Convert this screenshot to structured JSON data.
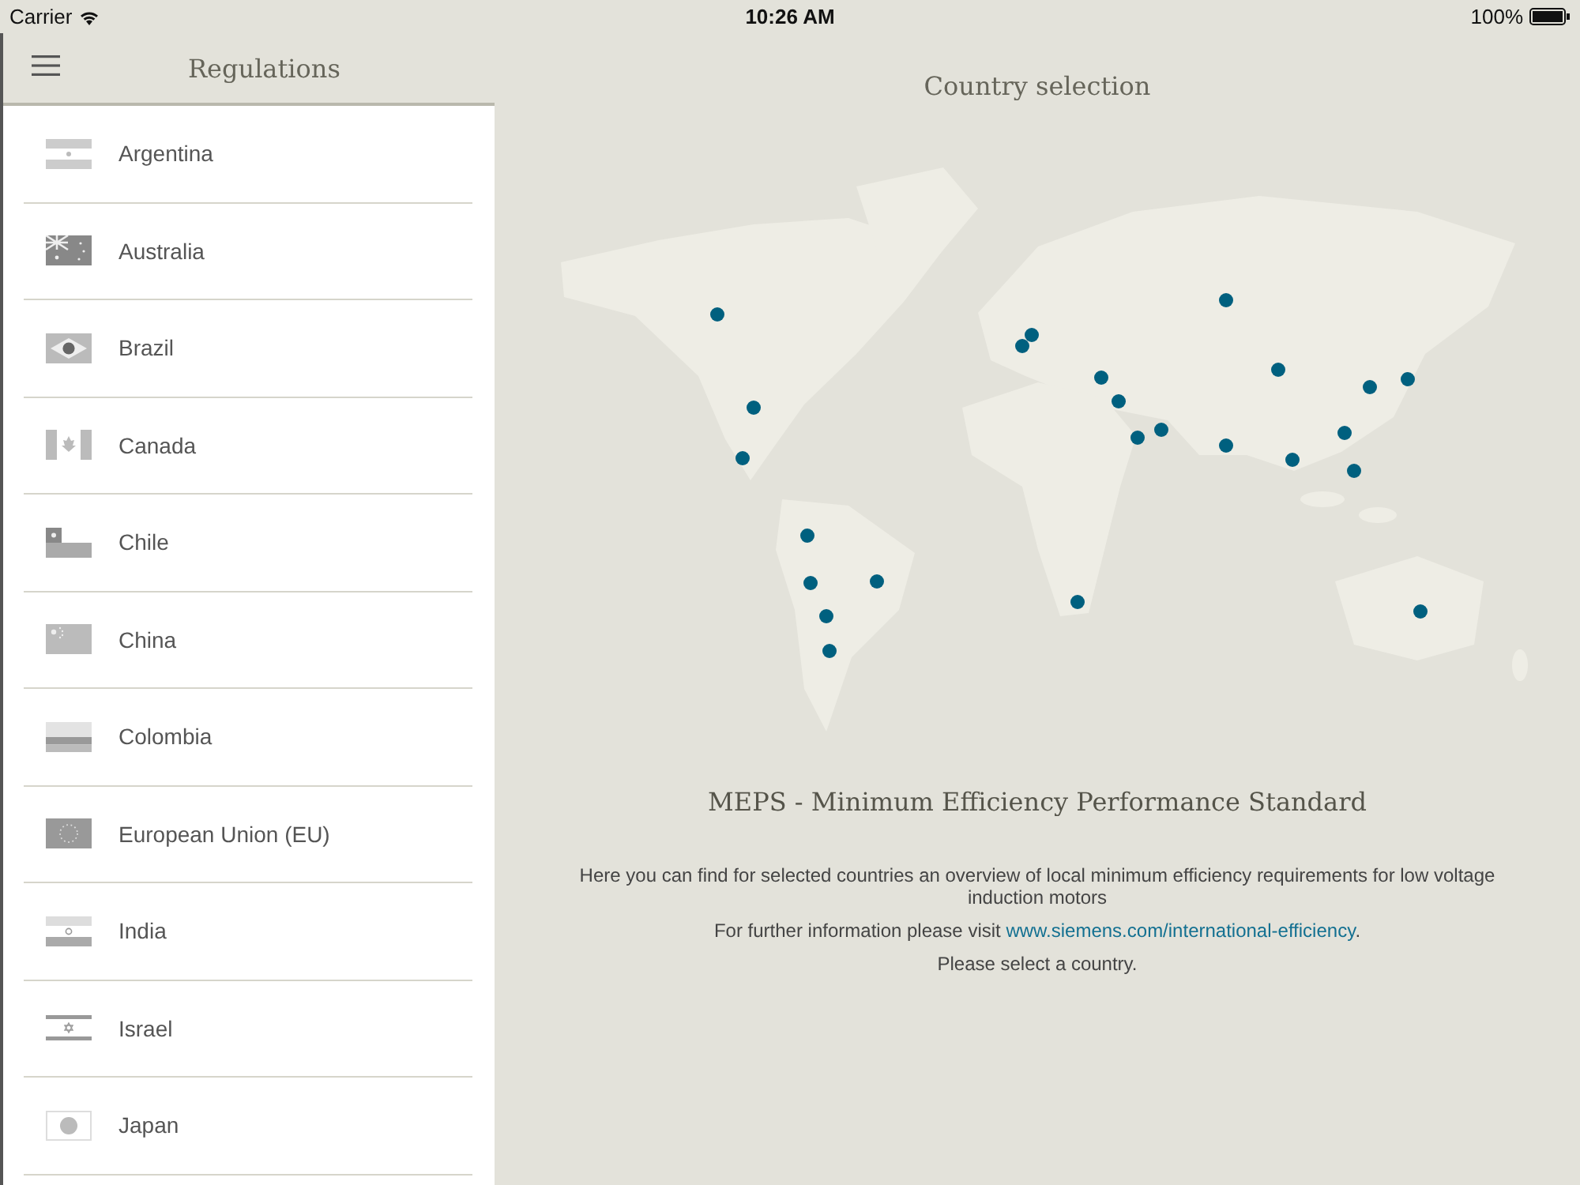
{
  "status_bar": {
    "carrier": "Carrier",
    "time": "10:26 AM",
    "battery": "100%"
  },
  "sidebar": {
    "title": "Regulations",
    "items": [
      {
        "label": "Argentina"
      },
      {
        "label": "Australia"
      },
      {
        "label": "Brazil"
      },
      {
        "label": "Canada"
      },
      {
        "label": "Chile"
      },
      {
        "label": "China"
      },
      {
        "label": "Colombia"
      },
      {
        "label": "European Union (EU)"
      },
      {
        "label": "India"
      },
      {
        "label": "Israel"
      },
      {
        "label": "Japan"
      }
    ]
  },
  "main": {
    "title": "Country selection",
    "heading": "MEPS - Minimum Efficiency Performance Standard",
    "description": "Here you can find for selected countries an overview of local minimum efficiency requirements for low voltage induction motors",
    "info_prefix": "For further information please visit ",
    "info_link": "www.siemens.com/international-efficiency",
    "info_suffix": ".",
    "prompt": "Please select a country."
  }
}
